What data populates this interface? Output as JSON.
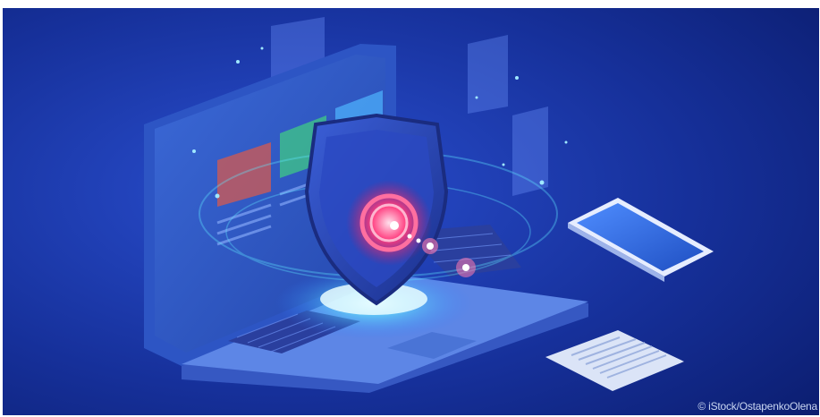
{
  "image": {
    "credit": "© iStock/OstapenkoOlena",
    "icons": [
      "laptop-icon",
      "shield-icon",
      "smartphone-icon",
      "document-icon"
    ]
  },
  "colors": {
    "background_deep": "#0b1f7a",
    "background_mid": "#1c3bb3",
    "glow_cyan": "#5fe6ff",
    "shield_core": "#ff3d7f",
    "laptop_body": "#4a74d6",
    "phone_screen": "#2f6ee0",
    "paper": "#dbe4f7"
  }
}
